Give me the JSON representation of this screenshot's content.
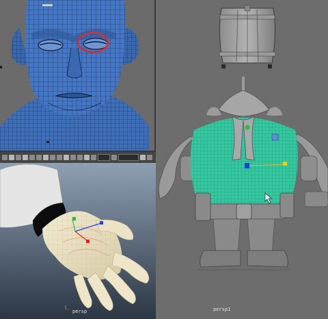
{
  "panels": {
    "head_viewport": {
      "hud_text": ""
    },
    "barrel_viewport": {
      "camera_label": "persp1"
    },
    "hand_window": {
      "camera_label": "persp"
    }
  },
  "colors": {
    "head_mesh": "#3f6fb8",
    "torso_selection": "#34c7a0",
    "viewport_bg": "#6d6d6d",
    "manipulator_red": "#e02020",
    "manipulator_green": "#20c040",
    "manipulator_blue": "#2040e0",
    "highlight_circle": "#e02a2a"
  }
}
